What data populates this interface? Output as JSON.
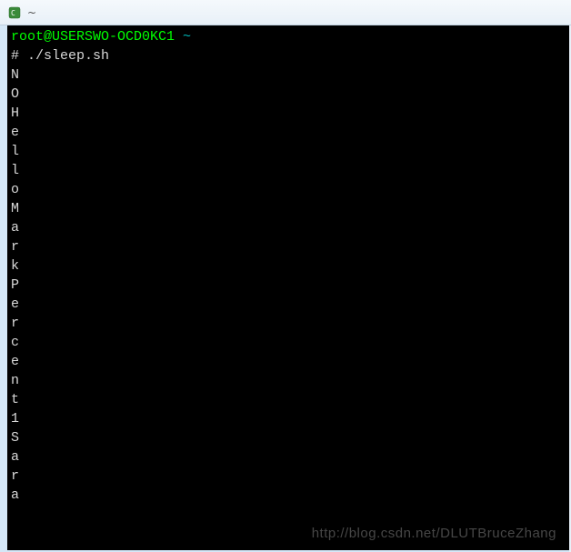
{
  "window": {
    "title": "~"
  },
  "terminal": {
    "prompt_user_host": "root@USERSWO-OCD0KC1",
    "prompt_cwd": "~",
    "command_prefix": "#",
    "command": "./sleep.sh",
    "output_chars": [
      "N",
      "O",
      "H",
      "e",
      "l",
      "l",
      "o",
      "M",
      "a",
      "r",
      "k",
      "P",
      "e",
      "r",
      "c",
      "e",
      "n",
      "t",
      "1",
      "S",
      "a",
      "r",
      "a"
    ]
  },
  "watermark": {
    "text": "http://blog.csdn.net/DLUTBruceZhang"
  },
  "icons": {
    "app": "terminal-icon"
  },
  "colors": {
    "prompt_user": "#00ff00",
    "prompt_path": "#00bbbb",
    "terminal_bg": "#000000",
    "terminal_fg": "#d8d8d8",
    "chrome_bg": "#e8f0f8"
  }
}
